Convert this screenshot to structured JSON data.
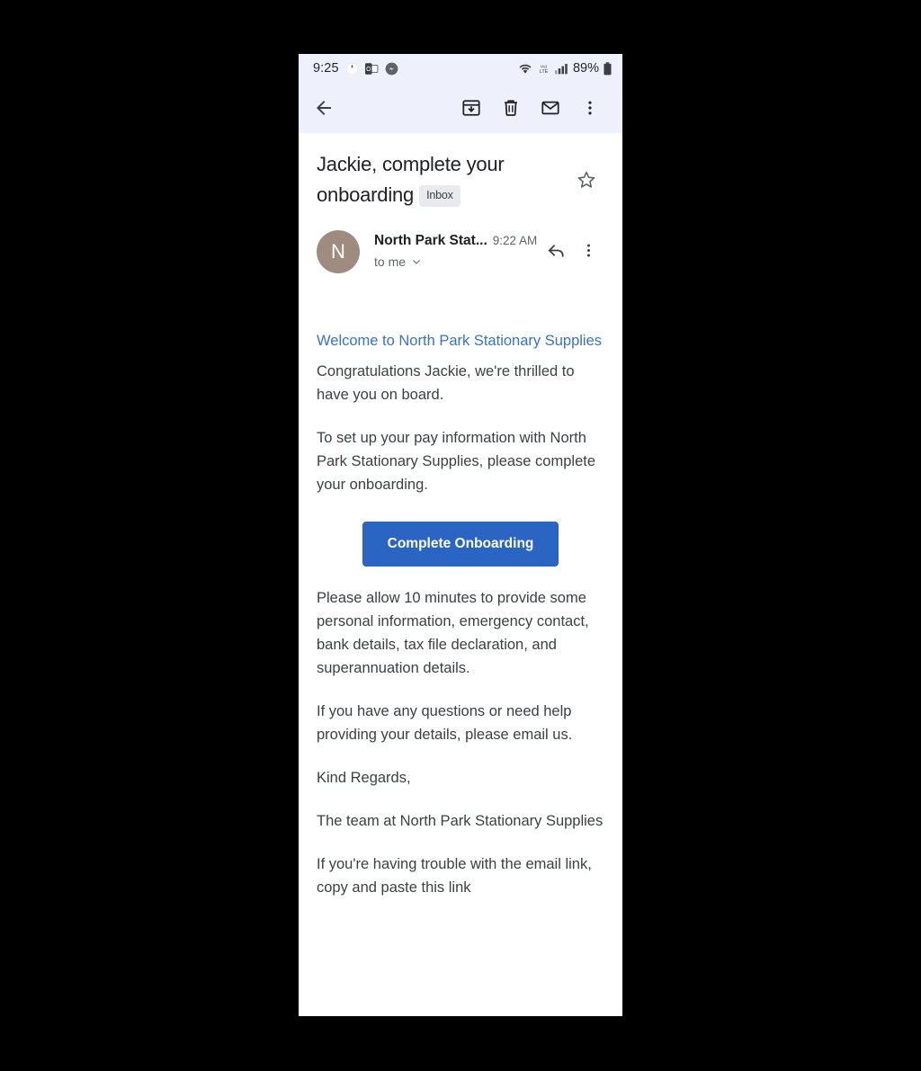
{
  "statusbar": {
    "time": "9:25",
    "battery": "89%",
    "network_label": "LTE",
    "volte_label": "VoLTE",
    "icons": [
      "browser-icon",
      "outlook-icon",
      "messenger-icon",
      "wifi-icon",
      "volte-icon",
      "signal-icon",
      "battery-icon"
    ]
  },
  "toolbar": {
    "back_label": "Back",
    "archive_label": "Archive",
    "delete_label": "Delete",
    "unread_label": "Mark as unread",
    "more_label": "More options"
  },
  "email": {
    "subject": "Jackie, complete your onboarding",
    "label_chip": "Inbox",
    "star_label": "Star",
    "sender_initial": "N",
    "sender_name": "North Park Stat...",
    "time": "9:22 AM",
    "recipient": "to me",
    "reply_label": "Reply",
    "more_label": "More options",
    "avatar_color": "#a08b81"
  },
  "body": {
    "heading_link": "Welcome to North Park Stationary Supplies",
    "p1": "Congratulations Jackie, we're thrilled to have you on board.",
    "p2": "To set up your pay information with North Park Stationary Supplies, please complete your onboarding.",
    "cta": "Complete Onboarding",
    "p3": "Please allow 10 minutes to provide some personal information, emergency contact, bank details, tax file declaration, and superannuation details.",
    "p4": "If you have any questions or need help providing your details, please email us.",
    "p5": "Kind Regards,",
    "p6": "The team at North Park Stationary Supplies",
    "p7": "If you're having trouble with the email link, copy and paste this link"
  },
  "colors": {
    "accent_blue": "#2b65c4",
    "link_blue": "#3a71c9",
    "toolbar_bg": "#eef1fb",
    "text_primary": "#202124",
    "text_secondary": "#5f6368"
  }
}
